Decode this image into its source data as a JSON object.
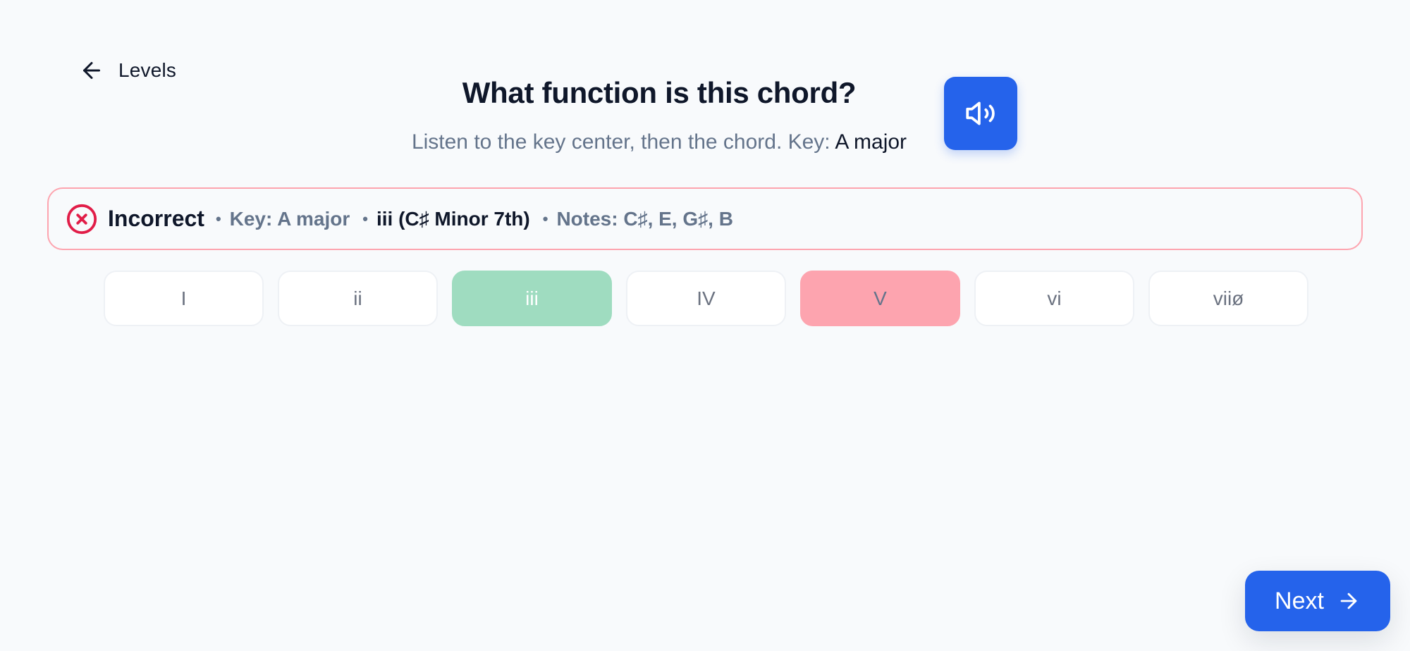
{
  "nav": {
    "back_label": "Levels",
    "back_icon": "arrow-left-icon"
  },
  "header": {
    "title": "What function is this chord?",
    "subtitle_prefix": "Listen to the key center, then the chord. Key: ",
    "subtitle_key": "A major",
    "audio_icon": "speaker-icon"
  },
  "feedback": {
    "status": "Incorrect",
    "status_icon": "x-circle-icon",
    "key_text": "Key: A major",
    "chord_text": "iii (C♯ Minor 7th)",
    "notes_text": "Notes: C♯, E, G♯, B"
  },
  "options": [
    {
      "label": "I",
      "state": "default"
    },
    {
      "label": "ii",
      "state": "default"
    },
    {
      "label": "iii",
      "state": "correct"
    },
    {
      "label": "IV",
      "state": "default"
    },
    {
      "label": "V",
      "state": "wrong"
    },
    {
      "label": "vi",
      "state": "default"
    },
    {
      "label": "viiø",
      "state": "default"
    }
  ],
  "next": {
    "label": "Next",
    "icon": "arrow-right-icon"
  },
  "colors": {
    "accent": "#2563eb",
    "correct": "#9fdcc0",
    "wrong": "#fda4af",
    "error_icon": "#e11d48"
  }
}
